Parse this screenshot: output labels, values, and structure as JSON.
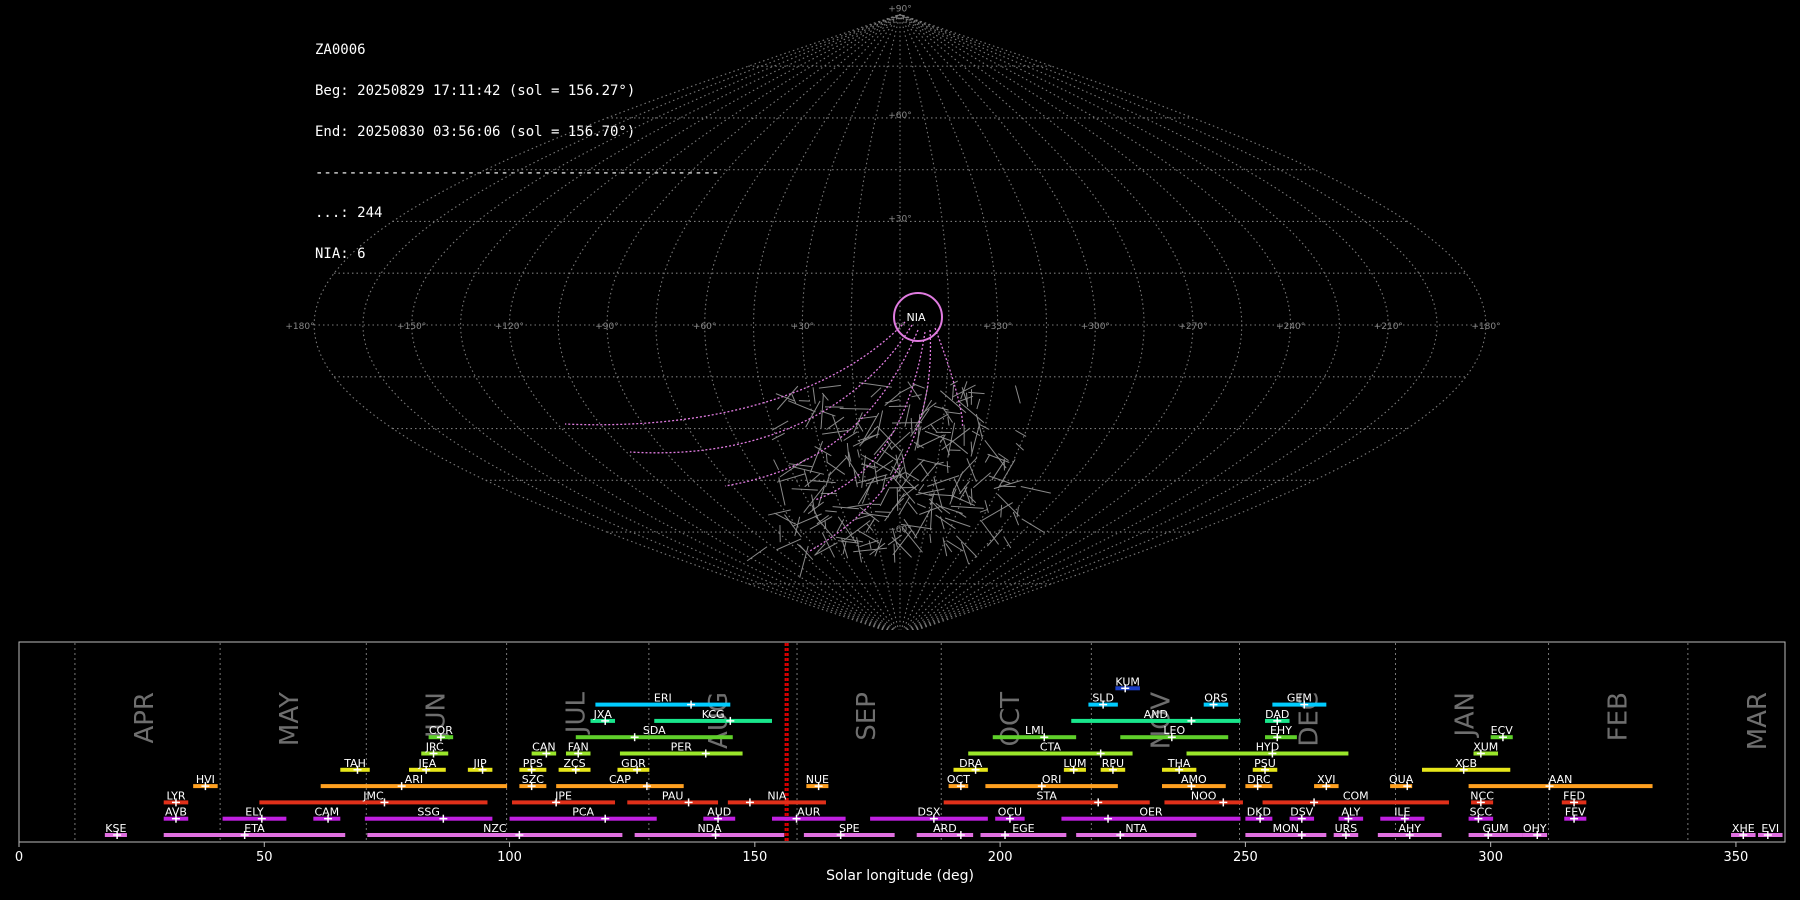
{
  "info": {
    "station": "ZA0006",
    "beg": "Beg: 20250829 17:11:42 (sol = 156.27°)",
    "end": "End: 20250830 03:56:06 (sol = 156.70°)",
    "separator": "------------------------------------------------",
    "count_sporadic": "...: 244",
    "count_nia": "NIA: 6"
  },
  "sky": {
    "lon_labels": [
      "+180°",
      "+150°",
      "+120°",
      "+90°",
      "+60°",
      "+30°",
      "0°",
      "+330°",
      "+300°",
      "+270°",
      "+240°",
      "+210°",
      "+180°"
    ],
    "lat_labels": [
      "+90°",
      "+60°",
      "+30°",
      "−60°",
      "−90°"
    ],
    "highlight_label": "NIA",
    "grid_color": "#7a7a7a",
    "highlight_color": "#e07be0",
    "track_color": "#8a8a8a"
  },
  "chart_data": {
    "type": "bar",
    "title": "",
    "xlabel": "Solar longitude (deg)",
    "ylabel": "",
    "xlim": [
      0,
      360
    ],
    "xticks": [
      0,
      50,
      100,
      150,
      200,
      250,
      300,
      350
    ],
    "current_sol": [
      156.27,
      156.7
    ],
    "months": [
      {
        "name": "APR",
        "start": 11.4
      },
      {
        "name": "MAY",
        "start": 41.0
      },
      {
        "name": "JUN",
        "start": 70.8
      },
      {
        "name": "JUL",
        "start": 99.4
      },
      {
        "name": "AUG",
        "start": 128.4
      },
      {
        "name": "SEP",
        "start": 158.6
      },
      {
        "name": "OCT",
        "start": 188.0
      },
      {
        "name": "NOV",
        "start": 218.6
      },
      {
        "name": "DEC",
        "start": 248.8
      },
      {
        "name": "JAN",
        "start": 280.6
      },
      {
        "name": "FEB",
        "start": 311.8
      },
      {
        "name": "MAR",
        "start": 340.2
      }
    ],
    "showers": [
      {
        "code": "KUM",
        "start": 223.5,
        "end": 228.5,
        "peak": 225.5,
        "row": 10,
        "color": "#1a3ec8"
      },
      {
        "code": "ERI",
        "start": 117.5,
        "end": 145.0,
        "peak": 137.0,
        "row": 9,
        "color": "#00ccff"
      },
      {
        "code": "SLD",
        "start": 218.0,
        "end": 224.0,
        "peak": 221.0,
        "row": 9,
        "color": "#00ccff"
      },
      {
        "code": "ORS",
        "start": 241.5,
        "end": 246.5,
        "peak": 243.5,
        "row": 9,
        "color": "#00ccff"
      },
      {
        "code": "GEM",
        "start": 255.5,
        "end": 266.5,
        "peak": 262.0,
        "row": 9,
        "color": "#00ccff"
      },
      {
        "code": "JXA",
        "start": 116.5,
        "end": 121.5,
        "peak": 119.5,
        "row": 8,
        "color": "#19e68c"
      },
      {
        "code": "KCG",
        "start": 129.5,
        "end": 153.5,
        "peak": 145.0,
        "row": 8,
        "color": "#19e68c"
      },
      {
        "code": "AND",
        "start": 214.5,
        "end": 249.0,
        "peak": 239.0,
        "row": 8,
        "color": "#19e68c"
      },
      {
        "code": "DAD",
        "start": 254.0,
        "end": 259.0,
        "peak": 256.5,
        "row": 8,
        "color": "#19e68c"
      },
      {
        "code": "COR",
        "start": 83.5,
        "end": 88.5,
        "peak": 86.0,
        "row": 7,
        "color": "#5fd02a"
      },
      {
        "code": "SDA",
        "start": 113.5,
        "end": 145.5,
        "peak": 125.5,
        "row": 7,
        "color": "#5fd02a"
      },
      {
        "code": "LMI",
        "start": 198.5,
        "end": 215.5,
        "peak": 209.0,
        "row": 7,
        "color": "#5fd02a"
      },
      {
        "code": "LEO",
        "start": 224.5,
        "end": 246.5,
        "peak": 235.0,
        "row": 7,
        "color": "#5fd02a"
      },
      {
        "code": "EHY",
        "start": 254.0,
        "end": 260.5,
        "peak": 256.5,
        "row": 7,
        "color": "#5fd02a"
      },
      {
        "code": "ECV",
        "start": 300.0,
        "end": 304.5,
        "peak": 302.5,
        "row": 7,
        "color": "#5fd02a"
      },
      {
        "code": "JRC",
        "start": 82.0,
        "end": 87.5,
        "peak": 84.5,
        "row": 6,
        "color": "#9ae62a"
      },
      {
        "code": "CAN",
        "start": 104.5,
        "end": 109.5,
        "peak": 107.5,
        "row": 6,
        "color": "#9ae62a"
      },
      {
        "code": "FAN",
        "start": 111.5,
        "end": 116.5,
        "peak": 114.0,
        "row": 6,
        "color": "#9ae62a"
      },
      {
        "code": "PER",
        "start": 122.5,
        "end": 147.5,
        "peak": 140.0,
        "row": 6,
        "color": "#9ae62a"
      },
      {
        "code": "CTA",
        "start": 193.5,
        "end": 227.0,
        "peak": 220.5,
        "row": 6,
        "color": "#9ae62a"
      },
      {
        "code": "HYD",
        "start": 238.0,
        "end": 271.0,
        "peak": 255.5,
        "row": 6,
        "color": "#9ae62a"
      },
      {
        "code": "XUM",
        "start": 296.5,
        "end": 301.5,
        "peak": 298.0,
        "row": 6,
        "color": "#9ae62a"
      },
      {
        "code": "TAH",
        "start": 65.5,
        "end": 71.5,
        "peak": 69.0,
        "row": 5,
        "color": "#e6e61a"
      },
      {
        "code": "JEA",
        "start": 79.5,
        "end": 87.0,
        "peak": 83.0,
        "row": 5,
        "color": "#e6e61a"
      },
      {
        "code": "JIP",
        "start": 91.5,
        "end": 96.5,
        "peak": 94.5,
        "row": 5,
        "color": "#e6e61a"
      },
      {
        "code": "PPS",
        "start": 102.0,
        "end": 107.5,
        "peak": 104.5,
        "row": 5,
        "color": "#e6e61a"
      },
      {
        "code": "ZCS",
        "start": 110.0,
        "end": 116.5,
        "peak": 113.5,
        "row": 5,
        "color": "#e6e61a"
      },
      {
        "code": "GDR",
        "start": 122.0,
        "end": 128.5,
        "peak": 126.0,
        "row": 5,
        "color": "#e6e61a"
      },
      {
        "code": "DRA",
        "start": 190.5,
        "end": 197.5,
        "peak": 195.0,
        "row": 5,
        "color": "#e6e61a"
      },
      {
        "code": "LUM",
        "start": 213.0,
        "end": 217.5,
        "peak": 215.0,
        "row": 5,
        "color": "#e6e61a"
      },
      {
        "code": "RPU",
        "start": 220.5,
        "end": 225.5,
        "peak": 223.0,
        "row": 5,
        "color": "#e6e61a"
      },
      {
        "code": "THA",
        "start": 233.0,
        "end": 240.0,
        "peak": 236.5,
        "row": 5,
        "color": "#e6e61a"
      },
      {
        "code": "PSU",
        "start": 251.5,
        "end": 256.5,
        "peak": 254.0,
        "row": 5,
        "color": "#e6e61a"
      },
      {
        "code": "XCB",
        "start": 286.0,
        "end": 304.0,
        "peak": 294.5,
        "row": 5,
        "color": "#e6e61a"
      },
      {
        "code": "HVI",
        "start": 35.5,
        "end": 40.5,
        "peak": 38.0,
        "row": 4,
        "color": "#ffa020"
      },
      {
        "code": "ARI",
        "start": 61.5,
        "end": 99.5,
        "peak": 78.0,
        "row": 4,
        "color": "#ffa020"
      },
      {
        "code": "SZC",
        "start": 102.0,
        "end": 107.5,
        "peak": 104.5,
        "row": 4,
        "color": "#ffa020"
      },
      {
        "code": "CAP",
        "start": 109.5,
        "end": 135.5,
        "peak": 128.0,
        "row": 4,
        "color": "#ffa020"
      },
      {
        "code": "NUE",
        "start": 160.5,
        "end": 165.0,
        "peak": 163.0,
        "row": 4,
        "color": "#ffa020"
      },
      {
        "code": "OCT",
        "start": 189.5,
        "end": 193.5,
        "peak": 192.0,
        "row": 4,
        "color": "#ffa020"
      },
      {
        "code": "ORI",
        "start": 197.0,
        "end": 224.0,
        "peak": 208.5,
        "row": 4,
        "color": "#ffa020"
      },
      {
        "code": "AMO",
        "start": 233.0,
        "end": 246.0,
        "peak": 239.0,
        "row": 4,
        "color": "#ffa020"
      },
      {
        "code": "DRC",
        "start": 250.0,
        "end": 255.5,
        "peak": 252.5,
        "row": 4,
        "color": "#ffa020"
      },
      {
        "code": "XVI",
        "start": 264.0,
        "end": 269.0,
        "peak": 266.5,
        "row": 4,
        "color": "#ffa020"
      },
      {
        "code": "QUA",
        "start": 279.5,
        "end": 284.0,
        "peak": 283.0,
        "row": 4,
        "color": "#ffa020"
      },
      {
        "code": "AAN",
        "start": 295.5,
        "end": 333.0,
        "peak": 312.0,
        "row": 4,
        "color": "#ffa020"
      },
      {
        "code": "LYR",
        "start": 29.5,
        "end": 34.5,
        "peak": 32.0,
        "row": 3,
        "color": "#e0301a"
      },
      {
        "code": "JMC",
        "start": 49.0,
        "end": 95.5,
        "peak": 74.5,
        "row": 3,
        "color": "#e0301a"
      },
      {
        "code": "JPE",
        "start": 100.5,
        "end": 121.5,
        "peak": 109.5,
        "row": 3,
        "color": "#e0301a"
      },
      {
        "code": "PAU",
        "start": 124.0,
        "end": 142.5,
        "peak": 136.5,
        "row": 3,
        "color": "#e0301a"
      },
      {
        "code": "NIA",
        "start": 144.5,
        "end": 164.5,
        "peak": 149.0,
        "row": 3,
        "color": "#e0301a"
      },
      {
        "code": "STA",
        "start": 188.5,
        "end": 230.5,
        "peak": 220.0,
        "row": 3,
        "color": "#e0301a"
      },
      {
        "code": "NOO",
        "start": 233.5,
        "end": 249.5,
        "peak": 245.5,
        "row": 3,
        "color": "#e0301a"
      },
      {
        "code": "COM",
        "start": 253.5,
        "end": 291.5,
        "peak": 264.0,
        "row": 3,
        "color": "#e0301a"
      },
      {
        "code": "NCC",
        "start": 296.0,
        "end": 300.5,
        "peak": 298.0,
        "row": 3,
        "color": "#e0301a"
      },
      {
        "code": "FED",
        "start": 314.5,
        "end": 319.5,
        "peak": 317.0,
        "row": 3,
        "color": "#e0301a"
      },
      {
        "code": "AVB",
        "start": 29.5,
        "end": 34.5,
        "peak": 32.0,
        "row": 2,
        "color": "#c020e0"
      },
      {
        "code": "ELY",
        "start": 41.5,
        "end": 54.5,
        "peak": 49.5,
        "row": 2,
        "color": "#c020e0"
      },
      {
        "code": "CAM",
        "start": 60.0,
        "end": 65.5,
        "peak": 63.0,
        "row": 2,
        "color": "#c020e0"
      },
      {
        "code": "SSG",
        "start": 70.5,
        "end": 96.5,
        "peak": 86.5,
        "row": 2,
        "color": "#c020e0"
      },
      {
        "code": "PCA",
        "start": 100.0,
        "end": 130.0,
        "peak": 119.5,
        "row": 2,
        "color": "#c020e0"
      },
      {
        "code": "AUD",
        "start": 139.5,
        "end": 146.0,
        "peak": 142.5,
        "row": 2,
        "color": "#c020e0"
      },
      {
        "code": "AUR",
        "start": 153.5,
        "end": 168.5,
        "peak": 158.5,
        "row": 2,
        "color": "#c020e0"
      },
      {
        "code": "DSX",
        "start": 173.5,
        "end": 197.5,
        "peak": 186.5,
        "row": 2,
        "color": "#c020e0"
      },
      {
        "code": "OCU",
        "start": 199.0,
        "end": 205.0,
        "peak": 202.0,
        "row": 2,
        "color": "#c020e0"
      },
      {
        "code": "OER",
        "start": 212.5,
        "end": 249.0,
        "peak": 222.0,
        "row": 2,
        "color": "#c020e0"
      },
      {
        "code": "DKD",
        "start": 250.0,
        "end": 255.5,
        "peak": 253.0,
        "row": 2,
        "color": "#c020e0"
      },
      {
        "code": "DSV",
        "start": 259.0,
        "end": 264.0,
        "peak": 261.5,
        "row": 2,
        "color": "#c020e0"
      },
      {
        "code": "ALY",
        "start": 269.0,
        "end": 274.0,
        "peak": 271.0,
        "row": 2,
        "color": "#c020e0"
      },
      {
        "code": "ILE",
        "start": 277.5,
        "end": 286.5,
        "peak": 282.5,
        "row": 2,
        "color": "#c020e0"
      },
      {
        "code": "SCC",
        "start": 295.5,
        "end": 300.5,
        "peak": 297.5,
        "row": 2,
        "color": "#c020e0"
      },
      {
        "code": "FEV",
        "start": 315.0,
        "end": 319.5,
        "peak": 317.0,
        "row": 2,
        "color": "#c020e0"
      },
      {
        "code": "KSE",
        "start": 17.5,
        "end": 22.0,
        "peak": 20.0,
        "row": 1,
        "color": "#e070e0"
      },
      {
        "code": "ETA",
        "start": 29.5,
        "end": 66.5,
        "peak": 46.0,
        "row": 1,
        "color": "#e070e0"
      },
      {
        "code": "NZC",
        "start": 71.0,
        "end": 123.0,
        "peak": 102.0,
        "row": 1,
        "color": "#e070e0"
      },
      {
        "code": "NDA",
        "start": 125.5,
        "end": 156.0,
        "peak": 142.0,
        "row": 1,
        "color": "#e070e0"
      },
      {
        "code": "SPE",
        "start": 160.0,
        "end": 178.5,
        "peak": 167.5,
        "row": 1,
        "color": "#e070e0"
      },
      {
        "code": "ARD",
        "start": 183.0,
        "end": 194.5,
        "peak": 192.0,
        "row": 1,
        "color": "#e070e0"
      },
      {
        "code": "EGE",
        "start": 196.0,
        "end": 213.5,
        "peak": 201.0,
        "row": 1,
        "color": "#e070e0"
      },
      {
        "code": "NTA",
        "start": 215.5,
        "end": 240.0,
        "peak": 224.5,
        "row": 1,
        "color": "#e070e0"
      },
      {
        "code": "MON",
        "start": 250.0,
        "end": 266.5,
        "peak": 261.5,
        "row": 1,
        "color": "#e070e0"
      },
      {
        "code": "URS",
        "start": 268.0,
        "end": 273.0,
        "peak": 270.5,
        "row": 1,
        "color": "#e070e0"
      },
      {
        "code": "AHY",
        "start": 277.0,
        "end": 290.0,
        "peak": 283.5,
        "row": 1,
        "color": "#e070e0"
      },
      {
        "code": "GUM",
        "start": 295.5,
        "end": 306.5,
        "peak": 299.5,
        "row": 1,
        "color": "#e070e0"
      },
      {
        "code": "OHY",
        "start": 306.5,
        "end": 311.5,
        "peak": 309.5,
        "row": 1,
        "color": "#e070e0"
      },
      {
        "code": "XHE",
        "start": 349.0,
        "end": 354.0,
        "peak": 351.5,
        "row": 1,
        "color": "#e070e0"
      },
      {
        "code": "EVI",
        "start": 354.5,
        "end": 359.5,
        "peak": 356.5,
        "row": 1,
        "color": "#e070e0"
      }
    ]
  }
}
